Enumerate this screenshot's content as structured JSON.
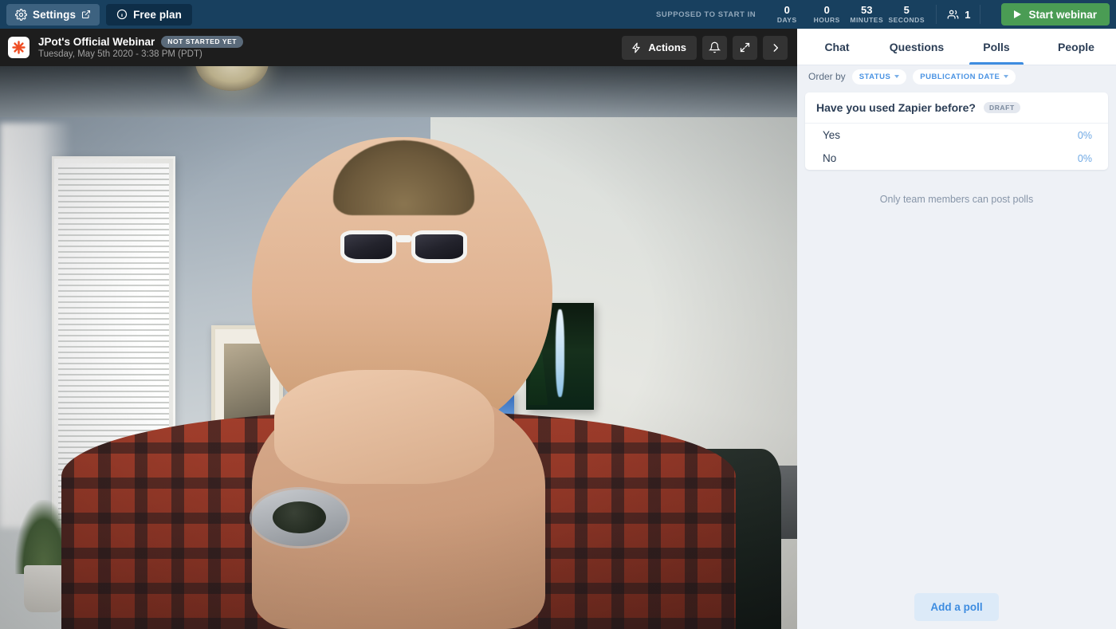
{
  "topbar": {
    "settings_label": "Settings",
    "free_plan_label": "Free plan",
    "countdown_label": "SUPPOSED TO START IN",
    "countdown": [
      {
        "value": "0",
        "unit": "DAYS"
      },
      {
        "value": "0",
        "unit": "HOURS"
      },
      {
        "value": "53",
        "unit": "MINUTES"
      },
      {
        "value": "5",
        "unit": "SECONDS"
      }
    ],
    "viewer_count": "1",
    "start_button_label": "Start webinar",
    "start_button_color": "#4a9c54",
    "background_color": "#18405f"
  },
  "webinar_header": {
    "title": "JPot's Official Webinar",
    "status_badge": "NOT STARTED YET",
    "datetime": "Tuesday, May 5th 2020 - 3:38 PM (PDT)",
    "actions_label": "Actions",
    "background_color": "#1d1d1d"
  },
  "panel": {
    "tabs": [
      {
        "label": "Chat",
        "active": false
      },
      {
        "label": "Questions",
        "active": false
      },
      {
        "label": "Polls",
        "active": true
      },
      {
        "label": "People",
        "active": false
      }
    ],
    "active_tab_color": "#3d8ce0",
    "order_by_label": "Order by",
    "filters": [
      {
        "label": "STATUS"
      },
      {
        "label": "PUBLICATION DATE"
      }
    ],
    "polls": [
      {
        "question": "Have you used Zapier before?",
        "status_badge": "DRAFT",
        "options": [
          {
            "label": "Yes",
            "percent": "0%"
          },
          {
            "label": "No",
            "percent": "0%"
          }
        ]
      }
    ],
    "note": "Only team members can post polls",
    "add_poll_label": "Add a poll",
    "background_color": "#eef1f6"
  }
}
